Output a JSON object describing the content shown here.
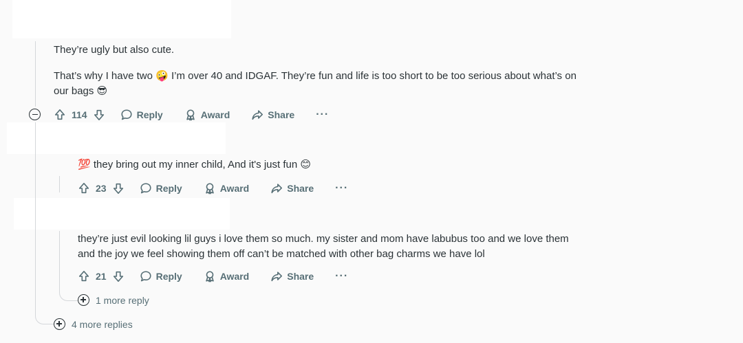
{
  "comments": [
    {
      "paragraphs": [
        "They’re ugly but also cute.",
        "That’s why I have two 🤪 I’m over 40 and IDGAF. They’re fun and life is too short to be too serious about what’s on our bags 😎"
      ],
      "score": "114",
      "reply_label": "Reply",
      "award_label": "Award",
      "share_label": "Share",
      "more_label": "···"
    },
    {
      "paragraphs": [
        "💯 they bring out my inner child, And it's just fun 😊"
      ],
      "score": "23",
      "reply_label": "Reply",
      "award_label": "Award",
      "share_label": "Share",
      "more_label": "···"
    },
    {
      "paragraphs": [
        "they’re just evil looking lil guys i love them so much. my sister and mom have labubus too and we love them and the joy we feel showing them off can’t be matched with other bag charms we have lol"
      ],
      "score": "21",
      "reply_label": "Reply",
      "award_label": "Award",
      "share_label": "Share",
      "more_label": "···"
    }
  ],
  "more_reply_nested": "1 more reply",
  "more_replies_top": "4 more replies",
  "icons": {
    "upvote": "arrow-up-icon",
    "downvote": "arrow-down-icon",
    "reply": "speech-bubble-icon",
    "award": "award-ribbon-icon",
    "share": "share-arrow-icon",
    "collapse": "minus-circle-icon",
    "expand": "plus-circle-icon"
  },
  "colors": {
    "meta": "#576f76",
    "text": "#2a3236",
    "background": "#fafafa"
  }
}
